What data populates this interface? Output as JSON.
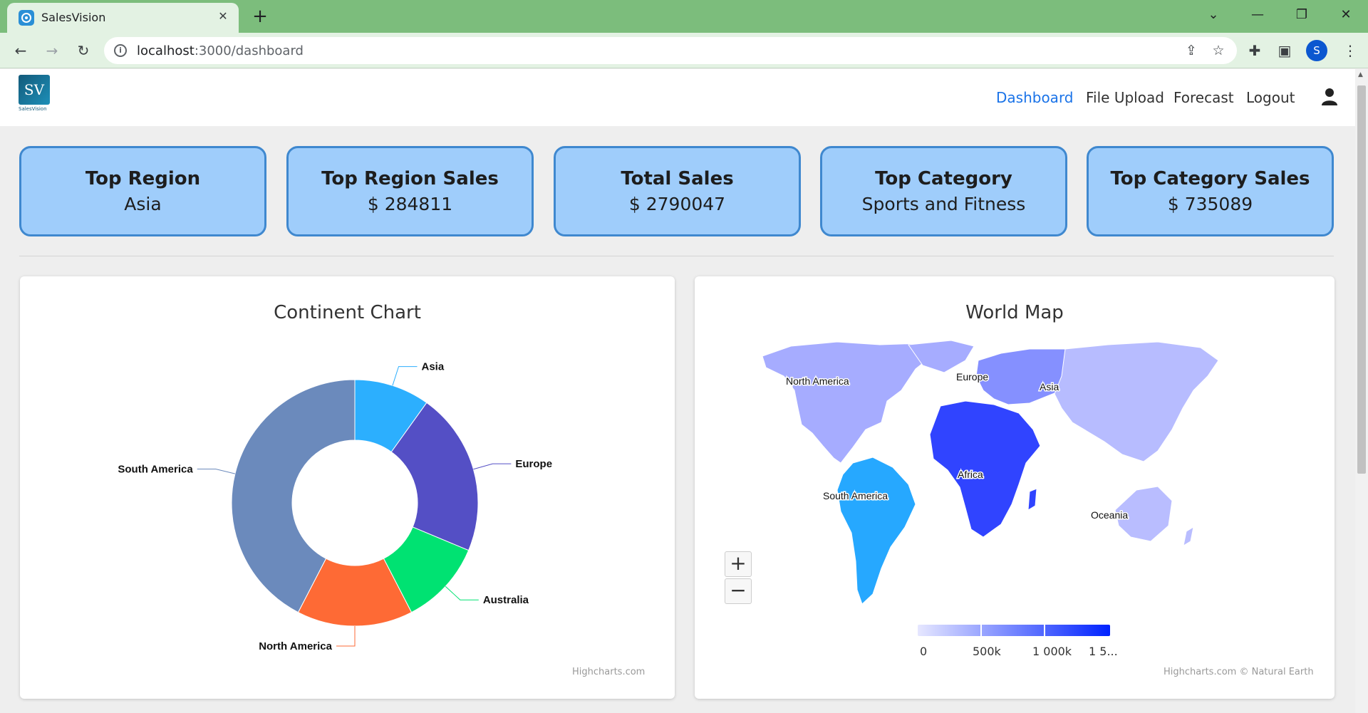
{
  "browser": {
    "tab_title": "SalesVision",
    "url_host": "localhost",
    "url_rest": ":3000/dashboard",
    "profile_initial": "S"
  },
  "app": {
    "logo_text": "SV",
    "logo_sub": "SalesVision",
    "nav": [
      "Dashboard",
      "File Upload",
      "Forecast",
      "Logout"
    ],
    "active_nav": "Dashboard"
  },
  "kpis": [
    {
      "title": "Top Region",
      "value": "Asia"
    },
    {
      "title": "Top Region Sales",
      "value": "$ 284811"
    },
    {
      "title": "Total Sales",
      "value": "$ 2790047"
    },
    {
      "title": "Top Category",
      "value": "Sports and Fitness"
    },
    {
      "title": "Top Category Sales",
      "value": "$ 735089"
    }
  ],
  "continent_chart": {
    "title": "Continent Chart",
    "credits": "Highcharts.com"
  },
  "world_map": {
    "title": "World Map",
    "credits": "Highcharts.com © Natural Earth",
    "regions": [
      {
        "name": "North America",
        "color": "#a6acff"
      },
      {
        "name": "Europe",
        "color": "#8590ff"
      },
      {
        "name": "Asia",
        "color": "#b7bcff"
      },
      {
        "name": "Africa",
        "color": "#3044ff"
      },
      {
        "name": "South America",
        "color": "#26a8ff"
      },
      {
        "name": "Oceania",
        "color": "#b9bdff"
      }
    ],
    "legend_labels": [
      "0",
      "500k",
      "1 000k",
      "1 5..."
    ],
    "legend_colors": [
      "#e6e7ff",
      "#0022ff"
    ]
  },
  "chart_data": {
    "type": "pie",
    "title": "Continent Chart",
    "inner_size": "50%",
    "series": [
      {
        "name": "",
        "data": [
          {
            "name": "Asia",
            "y": 9.9,
            "color": "#2caffe"
          },
          {
            "name": "Europe",
            "y": 21.4,
            "color": "#544fc5"
          },
          {
            "name": "Australia",
            "y": 11.1,
            "color": "#00e272"
          },
          {
            "name": "North America",
            "y": 15.2,
            "color": "#fe6a35"
          },
          {
            "name": "South America",
            "y": 42.4,
            "color": "#6b8abc"
          }
        ]
      }
    ]
  }
}
